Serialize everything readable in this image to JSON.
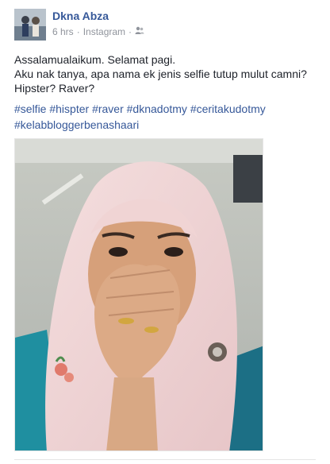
{
  "post": {
    "author": "Dkna Abza",
    "time": "6 hrs",
    "separator": "·",
    "source": "Instagram",
    "privacy_icon": "friends-icon",
    "text_lines": [
      "Assalamualaikum. Selamat pagi.",
      "Aku nak tanya, apa nama ek jenis selfie tutup mulut camni?",
      "Hipster? Raver?"
    ],
    "hashtags_row1": [
      "#selfie",
      "#hispter",
      "#raver",
      "#dknadotmy",
      "#ceritakudotmy"
    ],
    "hashtags_row2": [
      "#kelabbloggerbenashaari"
    ]
  },
  "colors": {
    "link": "#365899",
    "meta": "#90949c",
    "text": "#1d2129"
  }
}
